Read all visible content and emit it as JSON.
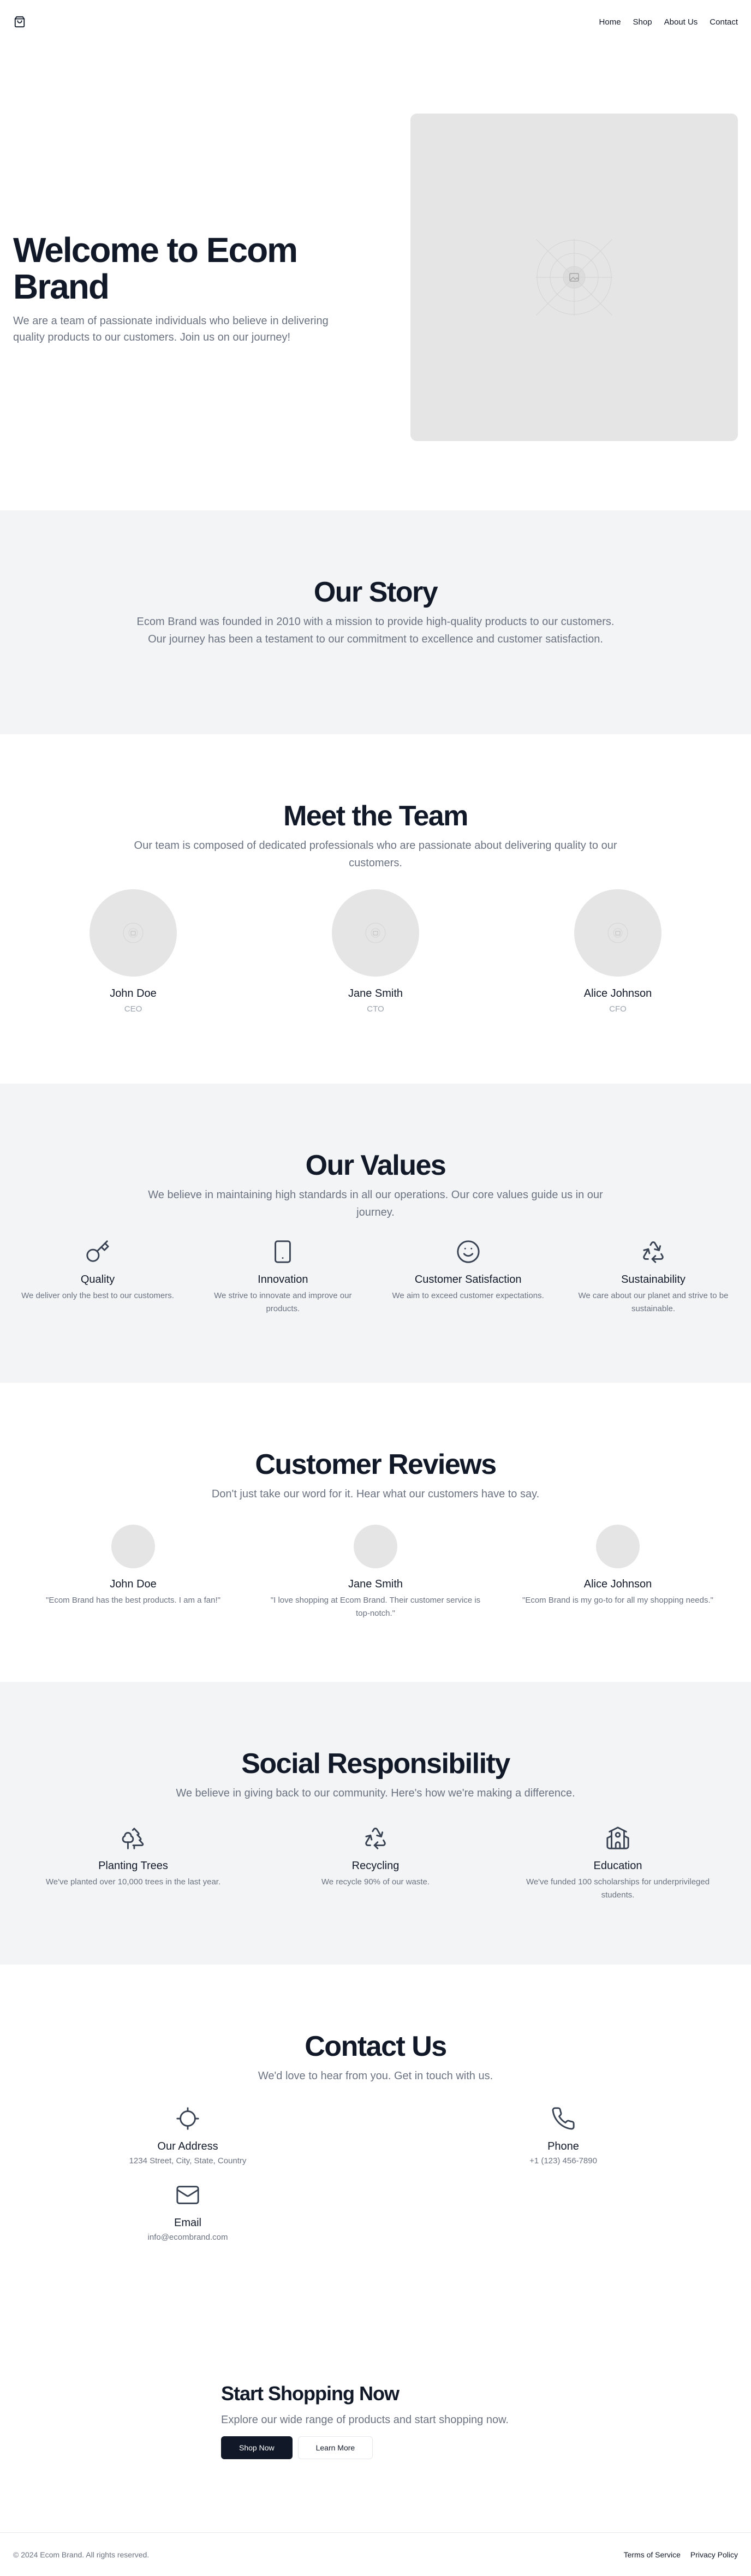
{
  "header": {
    "logo_icon": "shopping-bag-icon",
    "nav": [
      "Home",
      "Shop",
      "About Us",
      "Contact"
    ]
  },
  "hero": {
    "title": "Welcome to Ecom Brand",
    "subtitle": "We are a team of passionate individuals who believe in delivering quality products to our customers. Join us on our journey!",
    "image_icon": "image-placeholder-icon"
  },
  "story": {
    "title": "Our Story",
    "text": "Ecom Brand was founded in 2010 with a mission to provide high-quality products to our customers. Our journey has been a testament to our commitment to excellence and customer satisfaction."
  },
  "team": {
    "title": "Meet the Team",
    "subtitle": "Our team is composed of dedicated professionals who are passionate about delivering quality to our customers.",
    "members": [
      {
        "name": "John Doe",
        "role": "CEO"
      },
      {
        "name": "Jane Smith",
        "role": "CTO"
      },
      {
        "name": "Alice Johnson",
        "role": "CFO"
      }
    ]
  },
  "values": {
    "title": "Our Values",
    "subtitle": "We believe in maintaining high standards in all our operations. Our core values guide us in our journey.",
    "items": [
      {
        "title": "Quality",
        "desc": "We deliver only the best to our customers.",
        "icon": "key-icon"
      },
      {
        "title": "Innovation",
        "desc": "We strive to innovate and improve our products.",
        "icon": "smartphone-icon"
      },
      {
        "title": "Customer Satisfaction",
        "desc": "We aim to exceed customer expectations.",
        "icon": "smile-icon"
      },
      {
        "title": "Sustainability",
        "desc": "We care about our planet and strive to be sustainable.",
        "icon": "recycle-icon"
      }
    ]
  },
  "reviews": {
    "title": "Customer Reviews",
    "subtitle": "Don't just take our word for it. Hear what our customers have to say.",
    "items": [
      {
        "name": "John Doe",
        "text": "\"Ecom Brand has the best products. I am a fan!\""
      },
      {
        "name": "Jane Smith",
        "text": "\"I love shopping at Ecom Brand. Their customer service is top-notch.\""
      },
      {
        "name": "Alice Johnson",
        "text": "\"Ecom Brand is my go-to for all my shopping needs.\""
      }
    ]
  },
  "social": {
    "title": "Social Responsibility",
    "subtitle": "We believe in giving back to our community. Here's how we're making a difference.",
    "items": [
      {
        "title": "Planting Trees",
        "desc": "We've planted over 10,000 trees in the last year.",
        "icon": "trees-icon"
      },
      {
        "title": "Recycling",
        "desc": "We recycle 90% of our waste.",
        "icon": "recycle-icon"
      },
      {
        "title": "Education",
        "desc": "We've funded 100 scholarships for underprivileged students.",
        "icon": "school-icon"
      }
    ]
  },
  "contact": {
    "title": "Contact Us",
    "subtitle": "We'd love to hear from you. Get in touch with us.",
    "items": [
      {
        "title": "Our Address",
        "value": "1234 Street, City, State, Country",
        "icon": "locate-icon"
      },
      {
        "title": "Phone",
        "value": "+1 (123) 456-7890",
        "icon": "phone-icon"
      },
      {
        "title": "Email",
        "value": "info@ecombrand.com",
        "icon": "mail-icon"
      }
    ]
  },
  "shop": {
    "title": "Start Shopping Now",
    "subtitle": "Explore our wide range of products and start shopping now.",
    "primary": "Shop Now",
    "secondary": "Learn More"
  },
  "footer": {
    "copyright": "© 2024 Ecom Brand. All rights reserved.",
    "links": [
      "Terms of Service",
      "Privacy Policy"
    ]
  },
  "colors": {
    "text": "#111827",
    "muted": "#6b7280",
    "section_gray": "#f3f4f6",
    "placeholder": "#e5e5e5",
    "button_dark": "#111827"
  }
}
